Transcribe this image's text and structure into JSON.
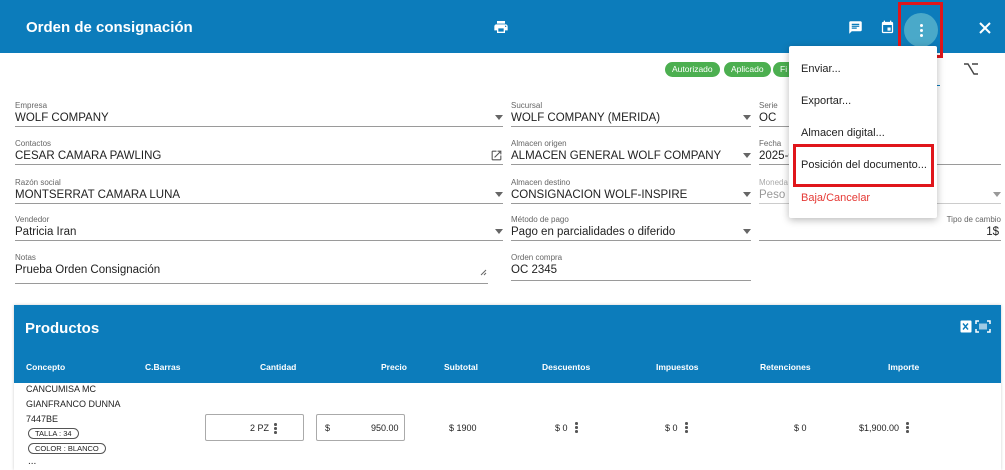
{
  "header": {
    "title": "Orden de consignación",
    "icons": [
      "print-icon",
      "comment-icon",
      "calendar-icon",
      "more-vert-icon",
      "close-icon"
    ]
  },
  "status_chips": [
    "Autorizado",
    "Aplicado",
    "Fi"
  ],
  "form": {
    "empresa": {
      "label": "Empresa",
      "value": "WOLF COMPANY"
    },
    "contactos": {
      "label": "Contactos",
      "value": "CESAR CAMARA PAWLING"
    },
    "razon_social": {
      "label": "Razón social",
      "value": "MONTSERRAT CAMARA LUNA"
    },
    "vendedor": {
      "label": "Vendedor",
      "value": "Patricia Iran"
    },
    "notas": {
      "label": "Notas",
      "value": "Prueba Orden Consignación"
    },
    "sucursal": {
      "label": "Sucursal",
      "value": "WOLF COMPANY (MERIDA)"
    },
    "almacen_origen": {
      "label": "Almacen origen",
      "value": "ALMACEN GENERAL WOLF COMPANY"
    },
    "almacen_destino": {
      "label": "Almacen destino",
      "value": "CONSIGNACION WOLF-INSPIRE"
    },
    "metodo_pago": {
      "label": "Método de pago",
      "value": "Pago en parcialidades o diferido"
    },
    "orden_compra": {
      "label": "Orden compra",
      "value": "OC 2345"
    },
    "serie": {
      "label": "Serie",
      "value": "OC"
    },
    "fecha": {
      "label": "Fecha",
      "value": "2025-0"
    },
    "moneda": {
      "label": "Moneda",
      "value": "Peso M"
    },
    "tipo_cambio": {
      "label": "Tipo de cambio",
      "value": "1$"
    }
  },
  "menu": {
    "items": [
      "Enviar...",
      "Exportar...",
      "Almacen digital...",
      "Posición del documento...",
      "Baja/Cancelar"
    ]
  },
  "productos": {
    "title": "Productos",
    "columns": [
      "Concepto",
      "C.Barras",
      "Cantidad",
      "Precio",
      "Subtotal",
      "Descuentos",
      "Impuestos",
      "Retenciones",
      "Importe"
    ],
    "row": {
      "concepto_lines": [
        "CANCUMISA MC",
        "GIANFRANCO DUNNA",
        "7447BE"
      ],
      "tags": [
        "TALLA : 34",
        "COLOR : BLANCO"
      ],
      "more": "...",
      "cantidad": "2 PZ",
      "precio_symbol": "$",
      "precio": "950.00",
      "subtotal": "$ 1900",
      "descuentos": "$ 0",
      "impuestos": "$ 0",
      "retenciones": "$ 0",
      "importe": "$1,900.00"
    }
  },
  "colors": {
    "primary": "#0c7cbb",
    "success": "#4caf50",
    "danger": "#e53935",
    "highlight": "#e0161b"
  }
}
